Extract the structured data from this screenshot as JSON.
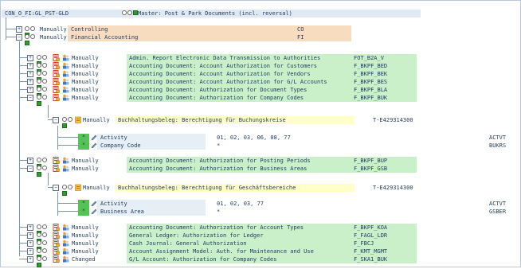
{
  "root": {
    "id": "CON_O_FI:GL_PST-GLD",
    "title": "Master: Post & Park Documents (incl. reversal)"
  },
  "top_nodes": [
    {
      "status": "Manually",
      "text": "Controlling",
      "code": "CO",
      "collapsed": true
    },
    {
      "status": "Manually",
      "text": "Financial Accounting",
      "code": "FI",
      "collapsed": false
    }
  ],
  "objects_a": [
    {
      "status": "Manually",
      "text": "Admin. Report Electronic Data Transmission to Authorities",
      "code": "FOT_B2A_V",
      "expanded": false
    },
    {
      "status": "Manually",
      "text": "Accounting Document: Account Authorization for Customers",
      "code": "F_BKPF_BED",
      "expanded": false
    },
    {
      "status": "Manually",
      "text": "Accounting Document: Account Authorization for Vendors",
      "code": "F_BKPF_BEK",
      "expanded": false
    },
    {
      "status": "Manually",
      "text": "Accounting Document: Account Authorization for G/L Accounts",
      "code": "F_BKPF_BES",
      "expanded": false
    },
    {
      "status": "Manually",
      "text": "Accounting Document: Authorization for Document Types",
      "code": "F_BKPF_BLA",
      "expanded": false
    },
    {
      "status": "Manually",
      "text": "Accounting Document: Authorization for Company Codes",
      "code": "F_BKPF_BUK",
      "expanded": true
    }
  ],
  "auth_1": {
    "status": "Manually",
    "text": "Buchhaltungsbeleg: Berechtigung für Buchungskreise",
    "code": "T-E429314300"
  },
  "fields_1": [
    {
      "name": "Activity",
      "value": "01, 02, 03, 06, 08, 77",
      "tech": "ACTVT"
    },
    {
      "name": "Company Code",
      "value": "*",
      "tech": "BUKRS"
    }
  ],
  "objects_b": [
    {
      "status": "Manually",
      "text": "Accounting Document: Authorization for Posting Periods",
      "code": "F_BKPF_BUP",
      "expanded": false
    },
    {
      "status": "Manually",
      "text": "Accounting Document: Authorization for Business Areas",
      "code": "F_BKPF_GSB",
      "expanded": true
    }
  ],
  "auth_2": {
    "status": "Manually",
    "text": "Buchhaltungsbeleg: Berechtigung für Geschäftsbereiche",
    "code": "T-E429314300"
  },
  "fields_2": [
    {
      "name": "Activity",
      "value": "01, 02, 03, 77",
      "tech": "ACTVT"
    },
    {
      "name": "Business Area",
      "value": "*",
      "tech": "GSBER"
    }
  ],
  "objects_c": [
    {
      "status": "Manually",
      "text": "Accounting Document: Authorization for Account Types",
      "code": "F_BKPF_KOA"
    },
    {
      "status": "Manually",
      "text": "General Ledger: Authorization for Ledger",
      "code": "F_FAGL_LDR"
    },
    {
      "status": "Manually",
      "text": "Cash Journal: General Authorization",
      "code": "F_FBCJ"
    },
    {
      "status": "Manually",
      "text": "Account Assignment Model: Auth. for Maintenance and Use",
      "code": "F_KMT_MGMT"
    },
    {
      "status": "Changed",
      "text": "G/L Account: Authorization for Company Codes",
      "code": "F_SKA1_BUK"
    }
  ],
  "colors": {
    "green_bg": "#c9f0c9",
    "orange_bg": "#f8dcc0",
    "yellow_bg": "#ffffc8",
    "header_bg": "#dfe9f3",
    "field_bg": "#e6eef6",
    "green_box": "#55c255"
  },
  "icons": {
    "status": "traffic-light-status-icon",
    "doc": "document-icon",
    "user": "user-auth-icon",
    "pencil": "pencil-edit-icon",
    "maintain": "maintain-icon"
  }
}
